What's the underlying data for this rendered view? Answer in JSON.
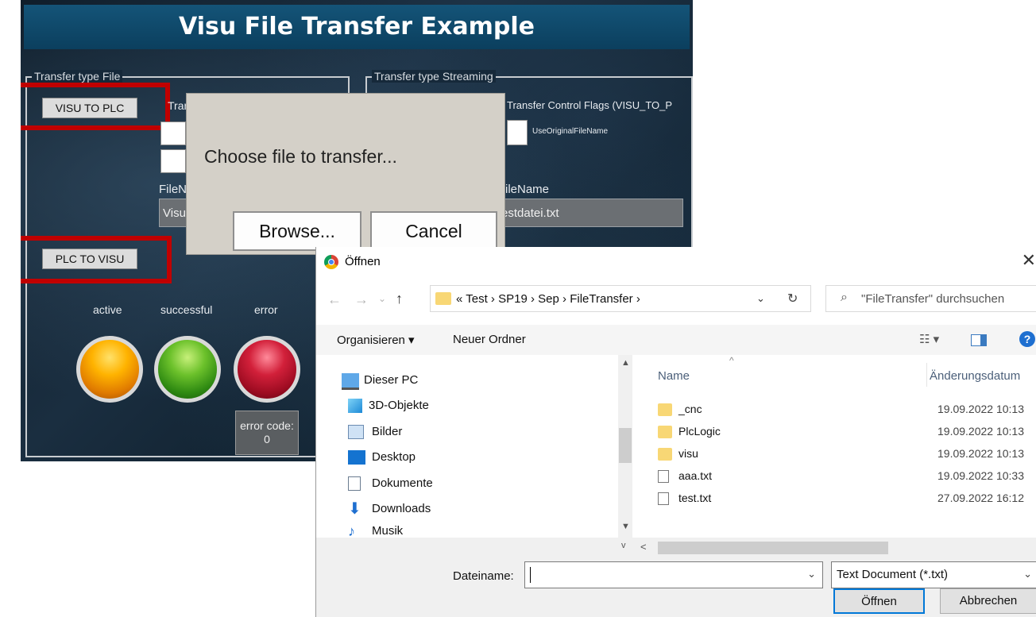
{
  "visu": {
    "title": "Visu File Transfer Example",
    "group_file": {
      "legend": "Transfer type File",
      "visu_to_plc": "VISU TO PLC",
      "plc_to_visu": "PLC TO VISU",
      "flags_label_partial": "Trans",
      "filename_label_partial": "FileN",
      "filename_value_partial": "Visu"
    },
    "group_stream": {
      "legend": "Transfer type Streaming",
      "flags_label": "Transfer Control Flags (VISU_TO_P",
      "use_original": "UseOriginalFileName",
      "filename_label": "ileName",
      "filename_value": "estdatei.txt"
    },
    "status": {
      "active": "active",
      "successful": "successful",
      "error": "error",
      "error_code_label": "error code:",
      "error_code_value": "0"
    }
  },
  "choose_dialog": {
    "message": "Choose file to transfer...",
    "browse": "Browse...",
    "cancel": "Cancel"
  },
  "open_dialog": {
    "title": "Öffnen",
    "breadcrumb": [
      "«",
      "Test",
      "SP19",
      "Sep",
      "FileTransfer"
    ],
    "search_placeholder": "\"FileTransfer\" durchsuchen",
    "toolbar": {
      "organize": "Organisieren ▾",
      "new_folder": "Neuer Ordner"
    },
    "nav_items": [
      {
        "label": "Dieser PC",
        "icon": "pc-icon"
      },
      {
        "label": "3D-Objekte",
        "icon": "cube-icon"
      },
      {
        "label": "Bilder",
        "icon": "pictures-icon"
      },
      {
        "label": "Desktop",
        "icon": "desktop-icon"
      },
      {
        "label": "Dokumente",
        "icon": "documents-icon"
      },
      {
        "label": "Downloads",
        "icon": "download-icon"
      },
      {
        "label": "Musik",
        "icon": "music-icon"
      }
    ],
    "columns": {
      "name": "Name",
      "date": "Änderungsdatum"
    },
    "files": [
      {
        "name": "_cnc",
        "date": "19.09.2022 10:13",
        "type": "folder"
      },
      {
        "name": "PlcLogic",
        "date": "19.09.2022 10:13",
        "type": "folder"
      },
      {
        "name": "visu",
        "date": "19.09.2022 10:13",
        "type": "folder"
      },
      {
        "name": "aaa.txt",
        "date": "19.09.2022 10:33",
        "type": "file"
      },
      {
        "name": "test.txt",
        "date": "27.09.2022 16:12",
        "type": "file"
      }
    ],
    "filename_label": "Dateiname:",
    "filename_value": "",
    "filetype": "Text Document (*.txt)",
    "open_button": "Öffnen",
    "cancel_button": "Abbrechen"
  },
  "colors": {
    "red_highlight": "#c00000",
    "title_bar": "#145478",
    "folder": "#f8d775"
  }
}
